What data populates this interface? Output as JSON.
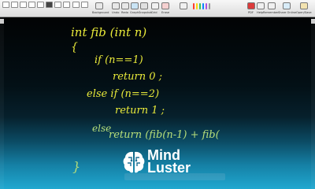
{
  "toolbar": {
    "labels": {
      "background": "Background",
      "undo": "Undo",
      "redo": "Redo",
      "graph": "Graph",
      "snapshot": "Snapshot",
      "grid": "Grid",
      "erase": "Erase",
      "pdf": "PDF",
      "help": "Help",
      "remember": "Remember",
      "share": "Share Online",
      "open": "Open/Save"
    },
    "pen_colors": [
      "#ff3b30",
      "#ffd60a",
      "#34c759",
      "#0a84ff",
      "#af52de",
      "#ffffff"
    ]
  },
  "code": {
    "line1": "int  fib (int  n)",
    "line2": "{",
    "line3": "if (n==1)",
    "line4": "return 0 ;",
    "line5": "else if (n==2)",
    "line6": "return 1 ;",
    "line7": "else",
    "line8": "return  (fib(n-1)  + fib(",
    "line9": "}"
  },
  "logo": {
    "line1": "Mind",
    "line2": "Luster"
  }
}
